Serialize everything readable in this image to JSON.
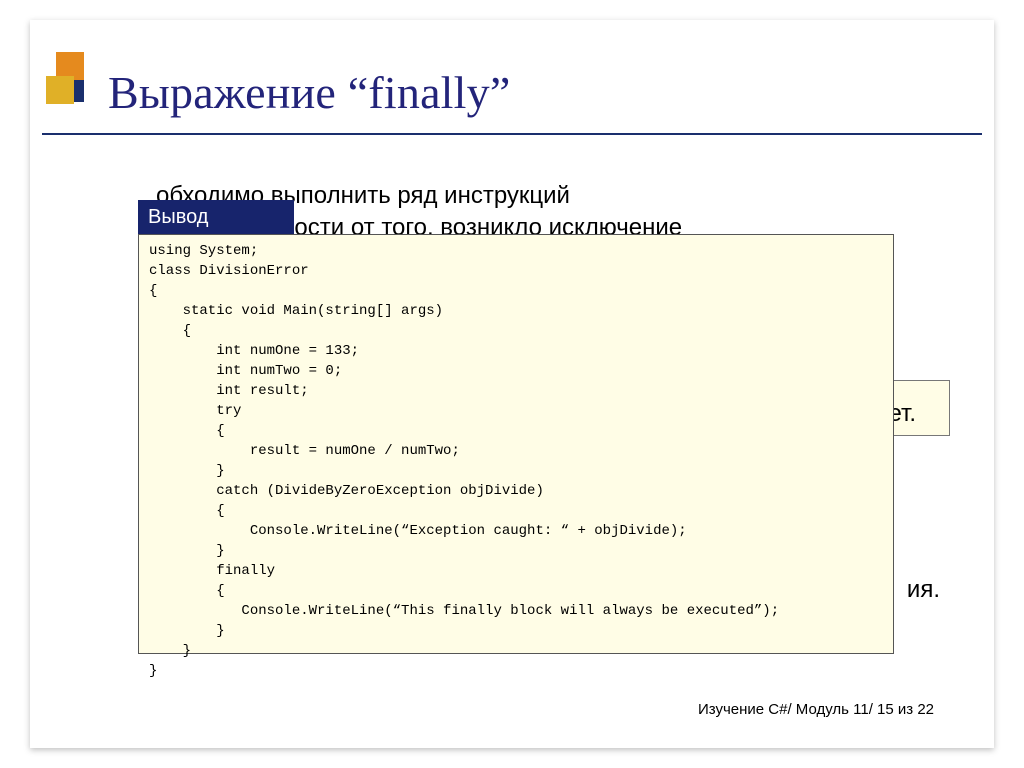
{
  "title": "Выражение “finally”",
  "background_text_line1": "обходимо выполнить ряд инструкций",
  "background_text_line2": "вне зависимости от того, возникло исключение",
  "frag_right_1": "нет.",
  "frag_right_2": "ия.",
  "output_label": "Вывод",
  "code": "using System;\nclass DivisionError\n{\n    static void Main(string[] args)\n    {\n        int numOne = 133;\n        int numTwo = 0;\n        int result;\n        try\n        {\n            result = numOne / numTwo;\n        }\n        catch (DivideByZeroException objDivide)\n        {\n            Console.WriteLine(“Exception caught: “ + objDivide);\n        }\n        finally\n        {\n           Console.WriteLine(“This finally block will always be executed”);\n        }\n    }\n}",
  "footer": "Изучение C#/ Модуль 11/ 15 из 22"
}
